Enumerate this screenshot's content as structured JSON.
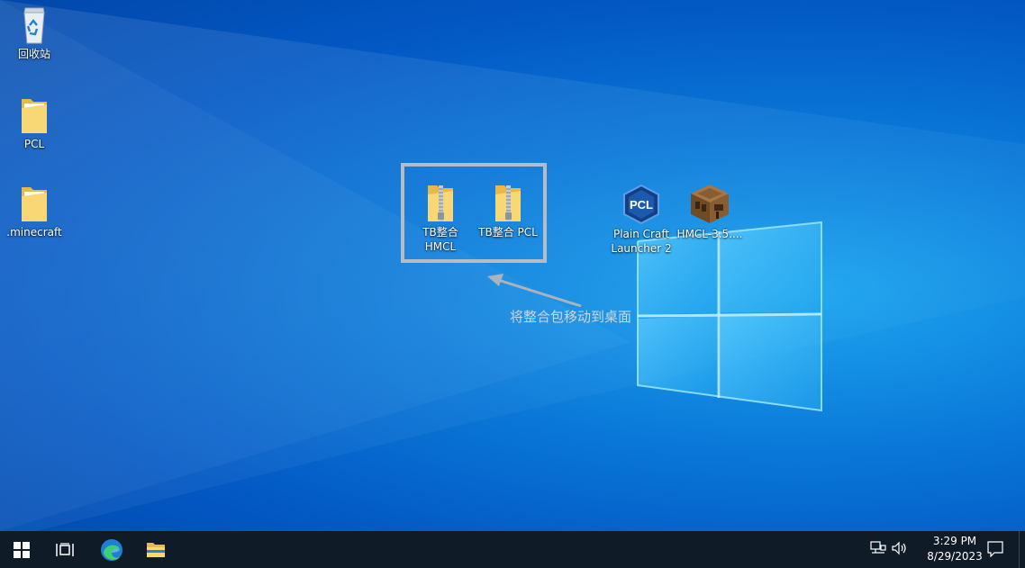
{
  "desktop": {
    "icons": [
      {
        "label": "回收站",
        "icon": "recycle-bin-icon"
      },
      {
        "label": "PCL",
        "icon": "folder-icon"
      },
      {
        "label": ".minecraft",
        "icon": "folder-icon"
      },
      {
        "label": "TB整合\nHMCL",
        "icon": "zip-folder-icon"
      },
      {
        "label": "TB整合 PCL",
        "icon": "zip-folder-icon"
      },
      {
        "label": "Plain Craft\nLauncher 2",
        "icon": "pcl-app-icon"
      },
      {
        "label": "HMCL-3.5....",
        "icon": "crafting-table-icon"
      }
    ],
    "pcl_badge_text": "PCL",
    "annotation": "将整合包移动到桌面",
    "highlight_color": "#b8bcc2"
  },
  "taskbar": {
    "background": "#101b28",
    "buttons": [
      {
        "name": "start",
        "icon": "windows-logo-icon"
      },
      {
        "name": "task-view",
        "icon": "task-view-icon"
      },
      {
        "name": "edge",
        "icon": "edge-icon"
      },
      {
        "name": "file-explorer",
        "icon": "folder-icon"
      }
    ],
    "tray": {
      "network_icon": "network-icon",
      "volume_icon": "volume-icon",
      "time": "3:29 PM",
      "date": "8/29/2023",
      "notification_icon": "notification-icon"
    }
  }
}
